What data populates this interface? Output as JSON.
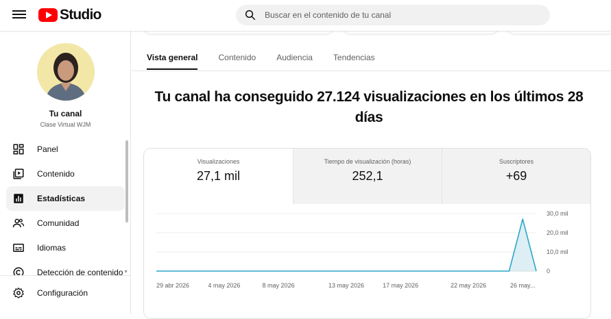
{
  "header": {
    "menu_icon": "hamburger-menu-icon",
    "logo_text": "Studio",
    "search_placeholder": "Buscar en el contenido de tu canal"
  },
  "sidebar": {
    "channel_name": "Tu canal",
    "channel_handle": "Clase Virtual WJM",
    "items": [
      {
        "label": "Panel",
        "icon": "dashboard-icon"
      },
      {
        "label": "Contenido",
        "icon": "content-icon"
      },
      {
        "label": "Estadísticas",
        "icon": "analytics-icon",
        "active": true
      },
      {
        "label": "Comunidad",
        "icon": "community-icon"
      },
      {
        "label": "Idiomas",
        "icon": "subtitles-icon"
      },
      {
        "label": "Detección de contenido",
        "icon": "copyright-icon"
      }
    ],
    "settings_label": "Configuración"
  },
  "tabs": [
    "Vista general",
    "Contenido",
    "Audiencia",
    "Tendencias"
  ],
  "headline": "Tu canal ha conseguido 27.124 visualizaciones en los últimos 28 días",
  "metrics": [
    {
      "label": "Visualizaciones",
      "value": "27,1 mil"
    },
    {
      "label": "Tiempo de visualización (horas)",
      "value": "252,1"
    },
    {
      "label": "Suscriptores",
      "value": "+69"
    }
  ],
  "colors": {
    "accent": "#2ba5c9",
    "area": "#d9edf4",
    "brand_red": "#ff0000"
  },
  "chart_data": {
    "type": "area",
    "x": [
      "29 abr 2026",
      "4 may 2026",
      "8 may 2026",
      "13 may 2026",
      "17 may 2026",
      "22 may 2026",
      "25 may 2026",
      "26 may 2026",
      "27 may 2026"
    ],
    "x_tick_labels": [
      "29 abr 2026",
      "4 may 2026",
      "8 may 2026",
      "13 may 2026",
      "17 may 2026",
      "22 may 2026",
      "26 may..."
    ],
    "series": [
      {
        "values": [
          0,
          0,
          0,
          0,
          0,
          0,
          0,
          27124,
          0
        ]
      }
    ],
    "y_tick_labels": [
      "0",
      "10,0 mil",
      "20,0 mil",
      "30,0 mil"
    ],
    "ylim": [
      0,
      30000
    ],
    "grid": true
  }
}
